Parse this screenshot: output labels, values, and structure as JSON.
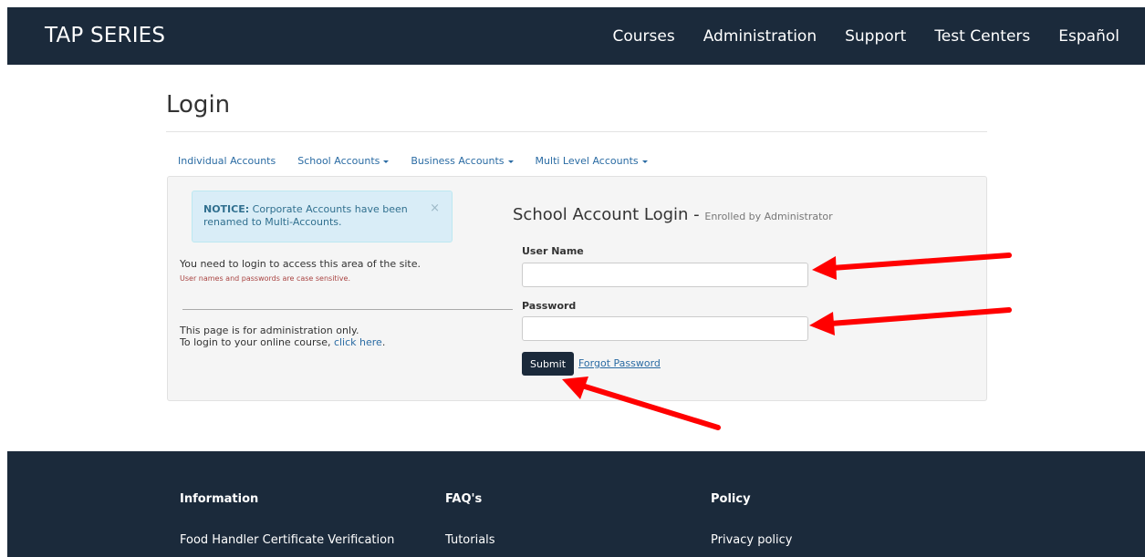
{
  "header": {
    "brand": "TAP SERIES",
    "nav": [
      "Courses",
      "Administration",
      "Support",
      "Test Centers",
      "Español"
    ]
  },
  "page": {
    "title": "Login"
  },
  "tabs": [
    {
      "label": "Individual Accounts",
      "dropdown": false
    },
    {
      "label": "School Accounts",
      "dropdown": true
    },
    {
      "label": "Business Accounts",
      "dropdown": true
    },
    {
      "label": "Multi Level Accounts",
      "dropdown": true
    }
  ],
  "notice": {
    "strong": "NOTICE:",
    "text": "Corporate Accounts have been renamed to Multi-Accounts.",
    "close": "×"
  },
  "left": {
    "message": "You need to login to access this area of the site.",
    "case_note": "User names and passwords are case sensitive.",
    "admin_line1": "This page is for administration only.",
    "admin_line2_prefix": "To login to your online course, ",
    "admin_link": "click here",
    "admin_line2_suffix": "."
  },
  "form": {
    "title": "School Account Login - ",
    "subtitle": "Enrolled by Administrator",
    "username_label": "User Name",
    "username_value": "",
    "password_label": "Password",
    "password_value": "",
    "submit_label": "Submit",
    "forgot_label": "Forgot Password"
  },
  "footer": {
    "columns": [
      {
        "heading": "Information",
        "link": "Food Handler Certificate Verification"
      },
      {
        "heading": "FAQ's",
        "link": "Tutorials"
      },
      {
        "heading": "Policy",
        "link": "Privacy policy"
      }
    ]
  },
  "colors": {
    "header_bg": "#1b2a3b",
    "link": "#2a6ba3",
    "notice_bg": "#d9edf7",
    "arrow": "#ff0000"
  }
}
